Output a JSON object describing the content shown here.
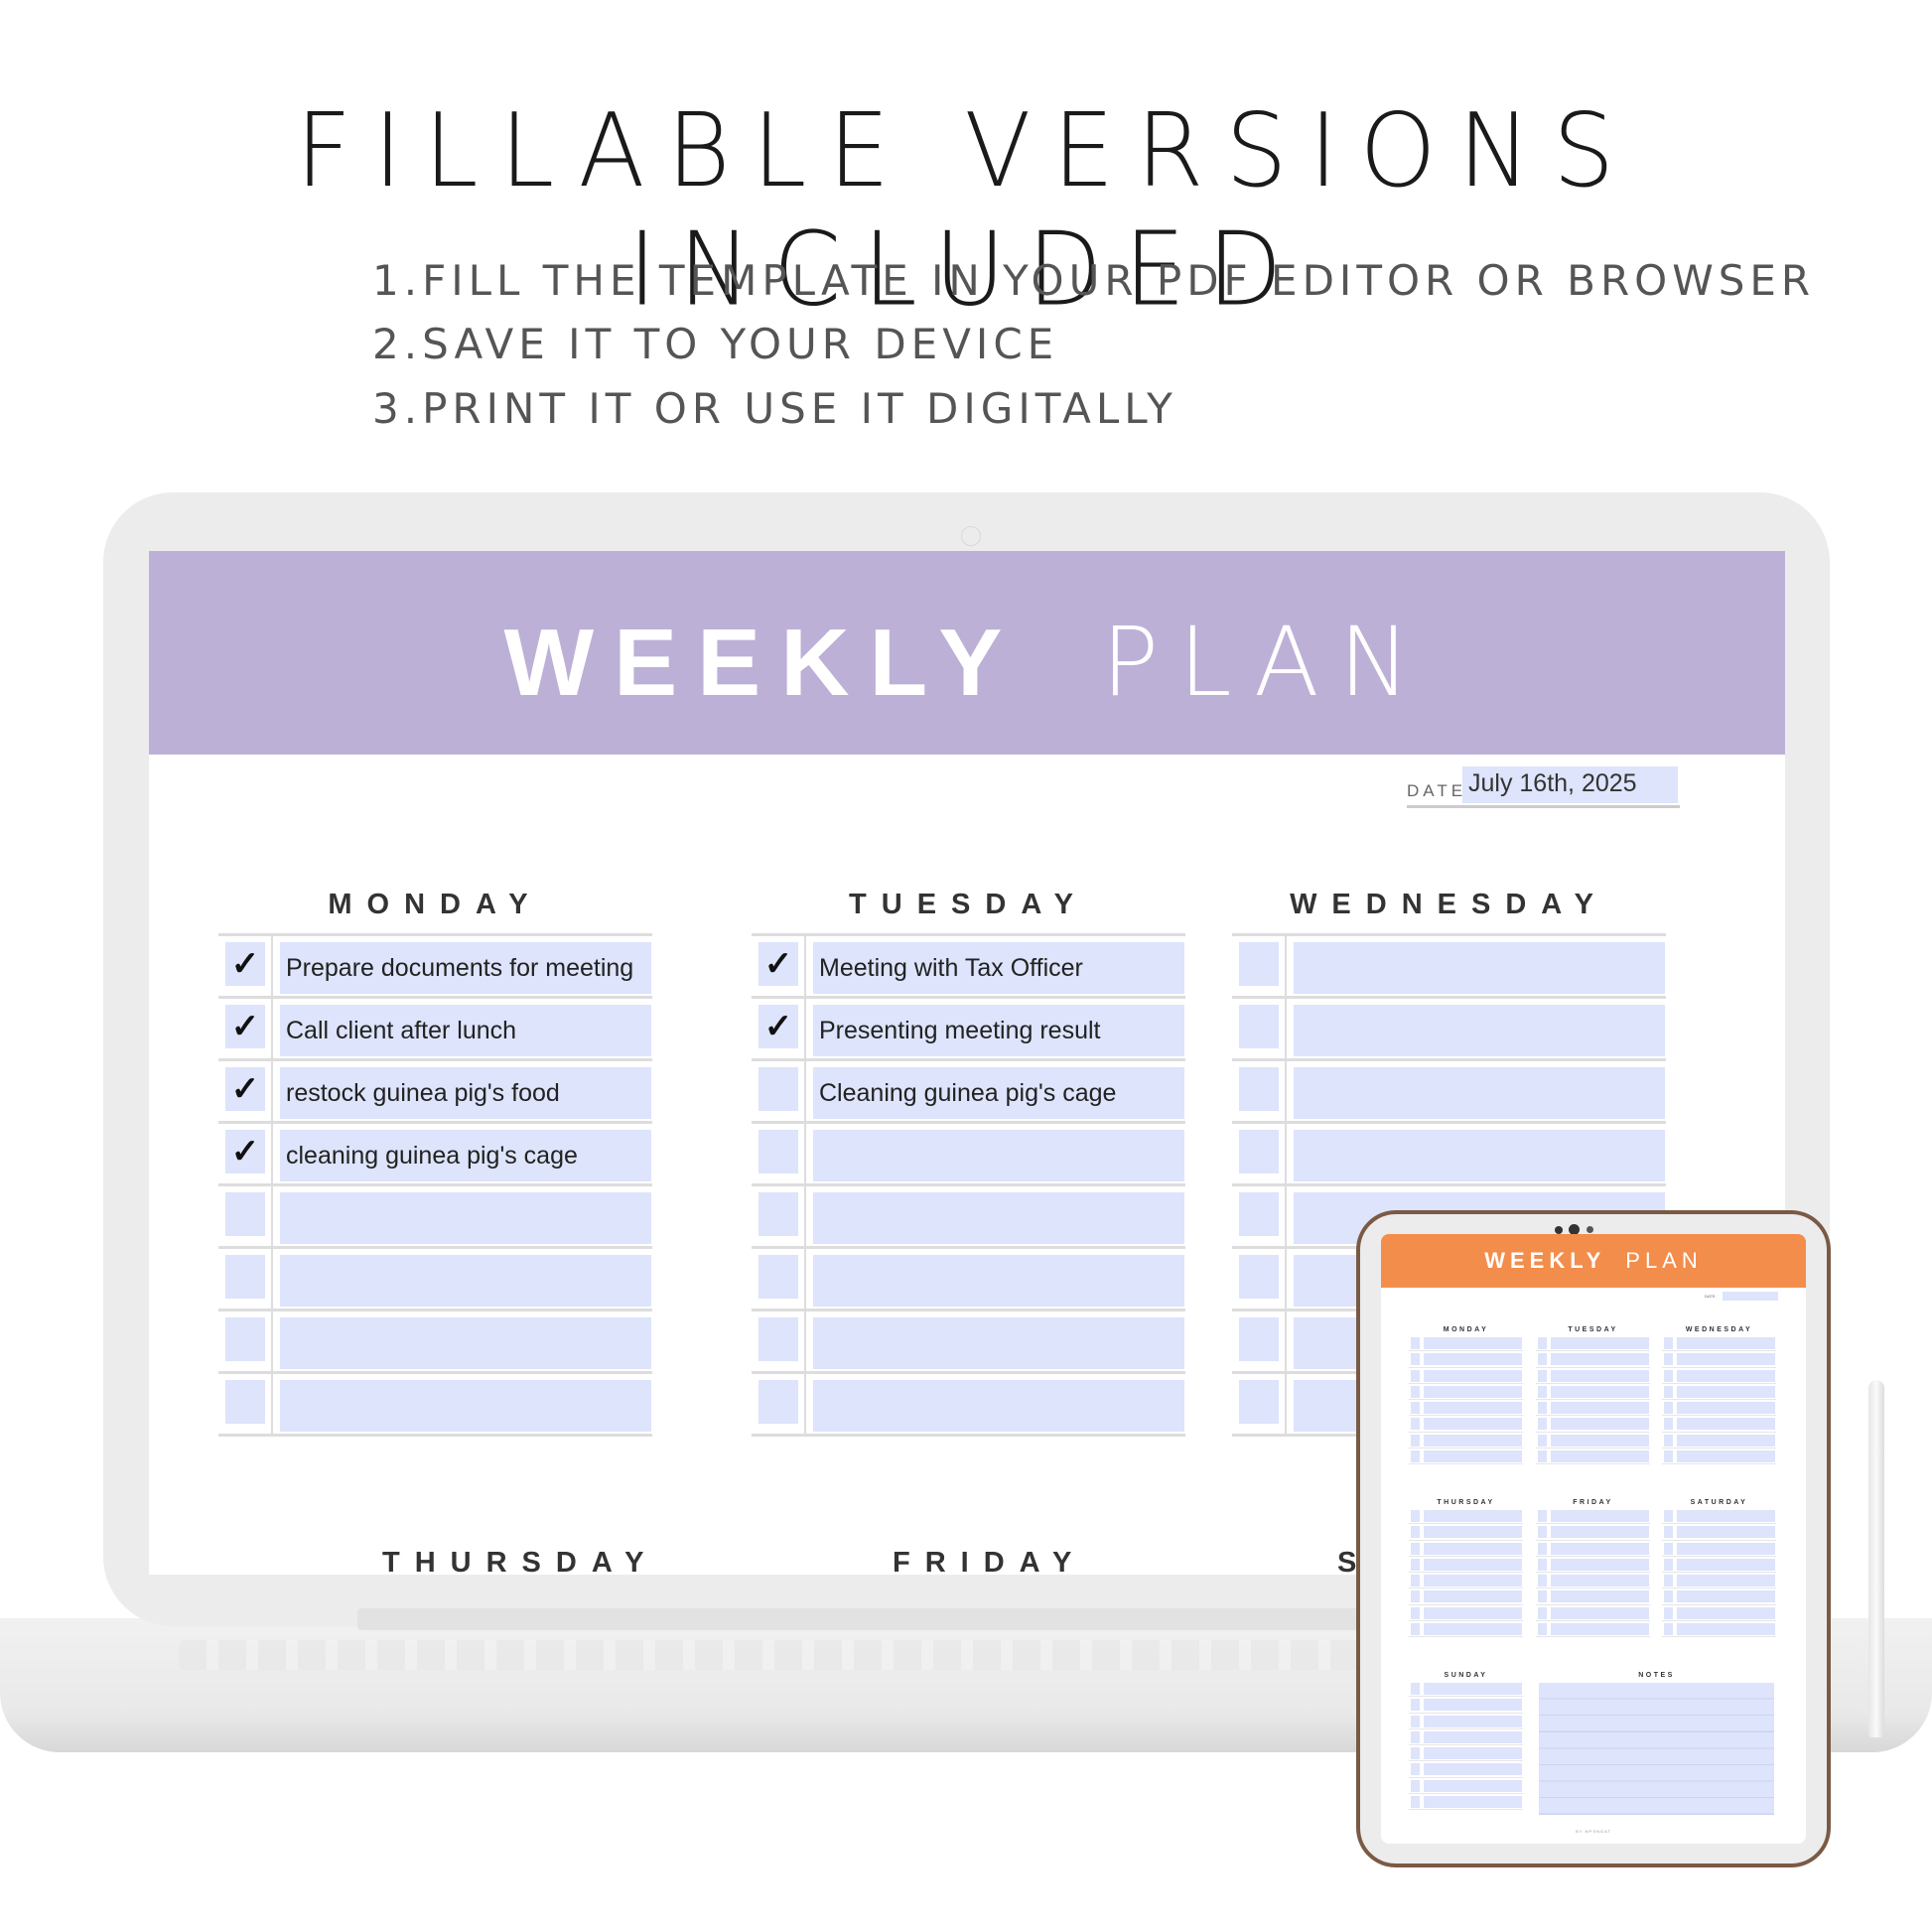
{
  "headline": "FILLABLE VERSIONS INCLUDED",
  "steps": [
    "1.FILL THE TEMPLATE IN YOUR PDF EDITOR OR BROWSER",
    "2.SAVE IT TO YOUR DEVICE",
    "3.PRINT IT OR USE IT DIGITALLY"
  ],
  "planner": {
    "title_bold": "WEEKLY",
    "title_light": "PLAN",
    "header_color": "#bdb0d6",
    "date_label": "DATE:",
    "date_value": "July 16th, 2025",
    "check_glyph": "✓",
    "days": [
      {
        "name": "MONDAY",
        "rows": [
          {
            "checked": true,
            "text": "Prepare documents for meeting"
          },
          {
            "checked": true,
            "text": "Call client after lunch"
          },
          {
            "checked": true,
            "text": "restock guinea pig's food"
          },
          {
            "checked": true,
            "text": "cleaning guinea pig's cage"
          },
          {
            "checked": false,
            "text": ""
          },
          {
            "checked": false,
            "text": ""
          },
          {
            "checked": false,
            "text": ""
          },
          {
            "checked": false,
            "text": ""
          }
        ]
      },
      {
        "name": "TUESDAY",
        "rows": [
          {
            "checked": true,
            "text": "Meeting with Tax Officer"
          },
          {
            "checked": true,
            "text": "Presenting meeting result"
          },
          {
            "checked": false,
            "text": "Cleaning guinea pig's cage"
          },
          {
            "checked": false,
            "text": ""
          },
          {
            "checked": false,
            "text": ""
          },
          {
            "checked": false,
            "text": ""
          },
          {
            "checked": false,
            "text": ""
          },
          {
            "checked": false,
            "text": ""
          }
        ]
      },
      {
        "name": "WEDNESDAY",
        "rows": [
          {
            "checked": false,
            "text": ""
          },
          {
            "checked": false,
            "text": ""
          },
          {
            "checked": false,
            "text": ""
          },
          {
            "checked": false,
            "text": ""
          },
          {
            "checked": false,
            "text": ""
          },
          {
            "checked": false,
            "text": ""
          },
          {
            "checked": false,
            "text": ""
          },
          {
            "checked": false,
            "text": ""
          }
        ]
      }
    ],
    "bottom_days": [
      "THURSDAY",
      "FRIDAY",
      "S"
    ]
  },
  "tablet": {
    "title_bold": "WEEKLY",
    "title_light": "PLAN",
    "header_color": "#f38d4b",
    "date_label": "DATE:",
    "days": [
      "MONDAY",
      "TUESDAY",
      "WEDNESDAY",
      "THURSDAY",
      "FRIDAY",
      "SATURDAY",
      "SUNDAY"
    ],
    "notes_label": "NOTES",
    "footer": "BY MPSNGAT"
  }
}
